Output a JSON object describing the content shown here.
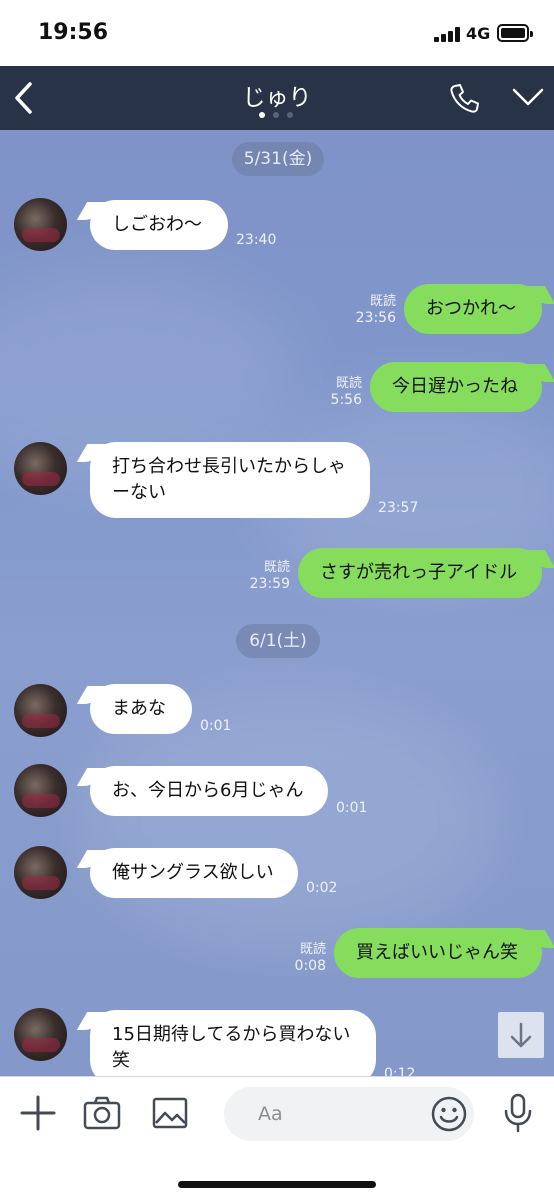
{
  "status_bar": {
    "time": "19:56",
    "network": "4G"
  },
  "header": {
    "title": "じゅり"
  },
  "colors": {
    "header": "#283347",
    "bubble_out": "#85dc5d",
    "bubble_in": "#ffffff",
    "chat_bg": "#8197cb"
  },
  "dates": [
    "5/31(金)",
    "6/1(土)"
  ],
  "messages": [
    {
      "side": "in",
      "text": "しごおわ〜",
      "time": "23:40"
    },
    {
      "side": "out",
      "text": "おつかれ〜",
      "read": "既読",
      "time": "23:56"
    },
    {
      "side": "out",
      "text": "今日遅かったね",
      "read": "既読",
      "time": "5:56"
    },
    {
      "side": "in",
      "text": "打ち合わせ長引いたからしゃーない",
      "time": "23:57"
    },
    {
      "side": "out",
      "text": "さすが売れっ子アイドル",
      "read": "既読",
      "time": "23:59"
    },
    {
      "side": "in",
      "text": "まあな",
      "time": "0:01"
    },
    {
      "side": "in",
      "text": "お、今日から6月じゃん",
      "time": "0:01"
    },
    {
      "side": "in",
      "text": "俺サングラス欲しい",
      "time": "0:02"
    },
    {
      "side": "out",
      "text": "買えばいいじゃん笑",
      "read": "既読",
      "time": "0:08"
    },
    {
      "side": "in",
      "text": "15日期待してるから買わない笑",
      "time": "0:12"
    }
  ],
  "input": {
    "placeholder": "Aa"
  },
  "icons": {
    "back": "chevron-left-icon",
    "call": "phone-icon",
    "menu": "chevron-down-icon",
    "add": "plus-icon",
    "camera": "camera-icon",
    "image": "image-icon",
    "emoji": "smiley-icon",
    "mic": "microphone-icon",
    "scroll": "arrow-down-icon"
  }
}
